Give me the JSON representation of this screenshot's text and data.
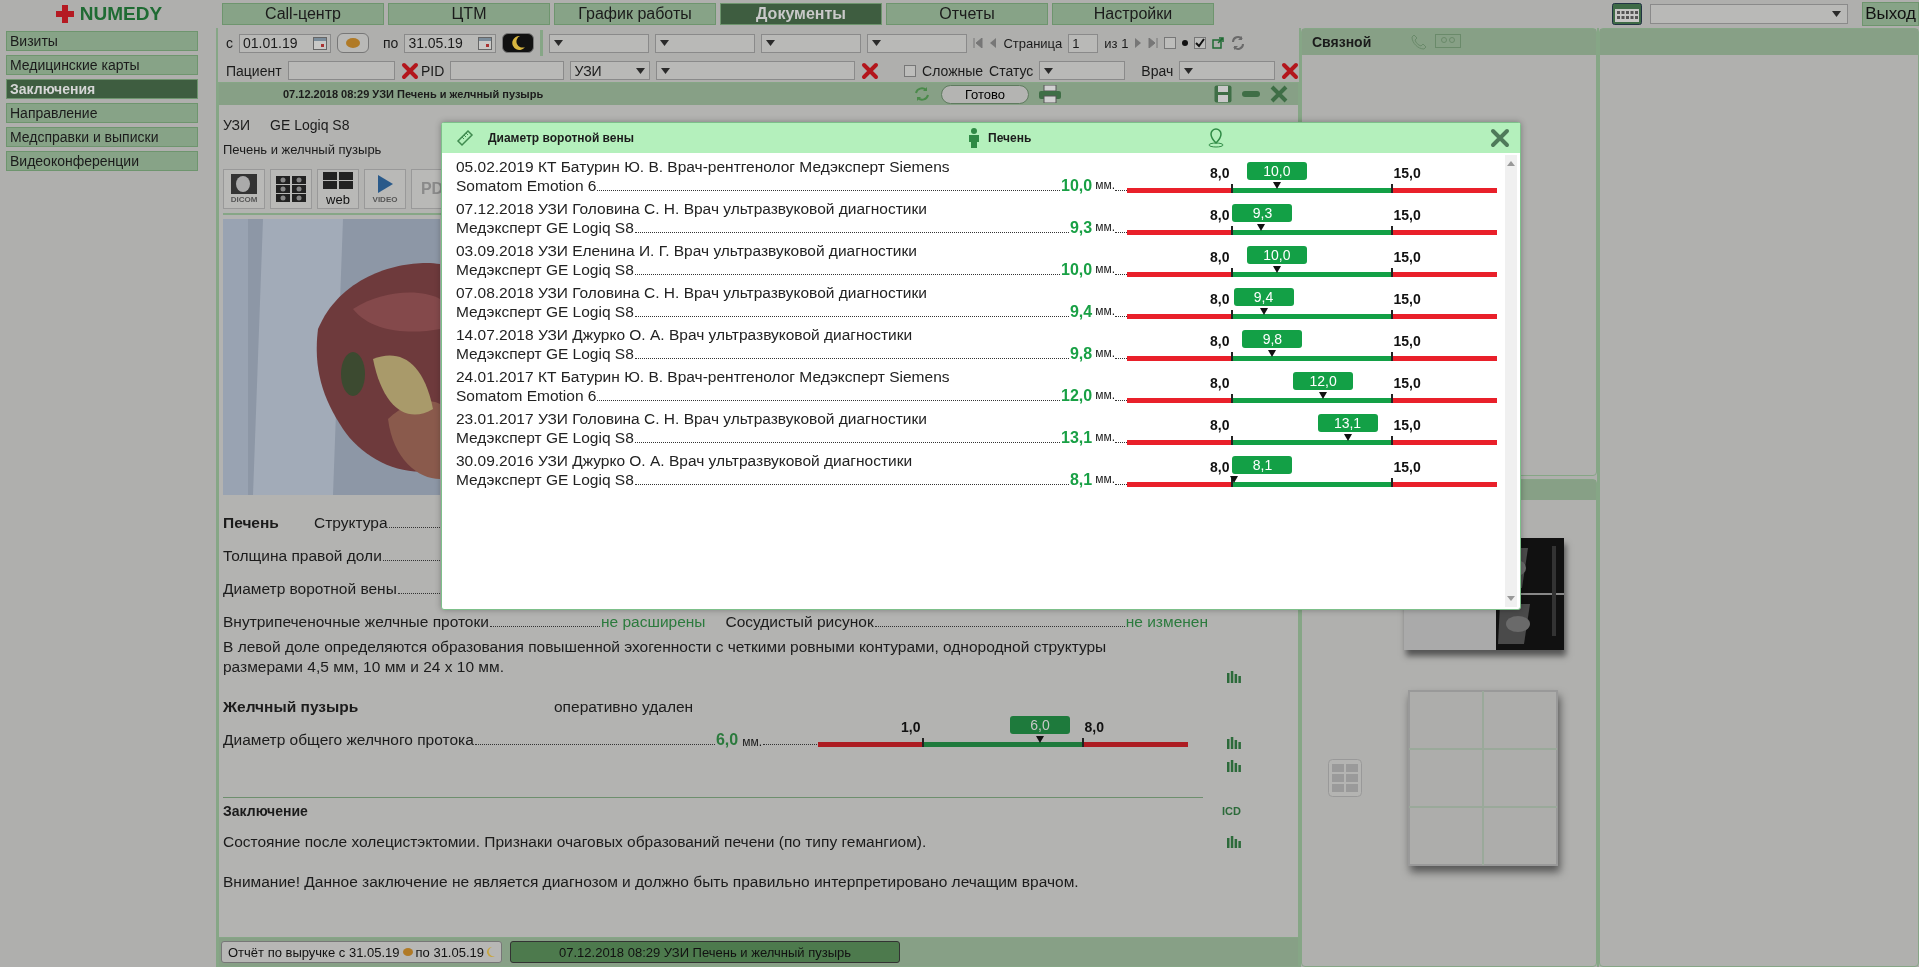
{
  "logo": "NUMEDY",
  "nav_tabs": [
    {
      "label": "Call-центр",
      "selected": false
    },
    {
      "label": "ЦТМ",
      "selected": false
    },
    {
      "label": "График работы",
      "selected": false
    },
    {
      "label": "Документы",
      "selected": true
    },
    {
      "label": "Отчеты",
      "selected": false
    },
    {
      "label": "Настройки",
      "selected": false
    }
  ],
  "exit_button": "Выход",
  "sidebar": {
    "items": [
      {
        "label": "Визиты",
        "selected": false
      },
      {
        "label": "Медицинские карты",
        "selected": false
      },
      {
        "label": "Заключения",
        "selected": true
      },
      {
        "label": "Направление",
        "selected": false
      },
      {
        "label": "Медсправки и выписки",
        "selected": false
      },
      {
        "label": "Видеоконференции",
        "selected": false
      }
    ]
  },
  "filters": {
    "from_label": "с",
    "date_from": "01.01.19",
    "to_label": "по",
    "date_to": "31.05.19",
    "page_label": "Страница",
    "page": "1",
    "page_total": "из 1",
    "show_all": {
      "checked": false
    },
    "show_mine": {
      "checked": true
    },
    "patient_label": "Пациент",
    "pid_label": "PID",
    "modality": "УЗИ",
    "complex": {
      "label": "Сложные",
      "checked": false
    },
    "status_label": "Статус",
    "doctor_label": "Врач"
  },
  "document": {
    "title": "07.12.2018 08:29 УЗИ Печень и желчный пузырь",
    "done_button": "Готово",
    "modality": "УЗИ",
    "device": "GE Logiq S8",
    "study": "Печень и желчный пузырь",
    "media_buttons": [
      {
        "kind": "dicom",
        "label": "DICOM"
      },
      {
        "kind": "images"
      },
      {
        "kind": "web",
        "label": "web"
      },
      {
        "kind": "video",
        "label": "VIDEO"
      },
      {
        "kind": "pdf",
        "label": "PD"
      }
    ],
    "liver": {
      "heading": "Печень",
      "fields": [
        "Структура",
        "Толщина правой доли",
        "Диаметр воротной вены"
      ],
      "pairs": [
        {
          "label": "Внутрипеченочные желчные протоки",
          "value": "не расширены"
        },
        {
          "label": "Сосудистый рисунок",
          "value": "не изменен"
        }
      ],
      "note": "В левой доле определяются образования повышенной эхогенности с четкими ровными контурами, однородной структуры размерами 4,5 мм, 10 мм и 24 х 10 мм."
    },
    "gallbladder": {
      "heading": "Желчный пузырь",
      "status": "оперативно удален",
      "measure": {
        "label": "Диаметр общего желчного протока",
        "value": "6,0",
        "unit": "мм.",
        "min": "1,0",
        "max": "8,0",
        "badge": "6,0",
        "level": 0.6
      }
    },
    "conclusion": {
      "heading": "Заключение",
      "code_label": "ICD",
      "text": "Состояние после холецистэктомии. Признаки очаговых образований печени (по типу гемангиом).",
      "warning": "Внимание! Данное заключение не является диагнозом и должно быть правильно интерпретировано лечащим врачом."
    }
  },
  "contacts_panel": {
    "title": "Связной"
  },
  "bottom_tabs": [
    {
      "label": "Отчёт по выручке с 31.05.19",
      "label_end": "по 31.05.19",
      "selected": false
    },
    {
      "label": "07.12.2018 08:29 УЗИ Печень и желчный пузырь",
      "selected": true
    }
  ],
  "dialog": {
    "title": "Диаметр воротной вены",
    "organ": "Печень",
    "rows": [
      {
        "line1": "05.02.2019 КТ Батурин Ю. В. Врач-рентгенолог Медэксперт Siemens",
        "line2": "Somatom Emotion 6",
        "value": "10,0",
        "unit": "мм.",
        "min": "8,0",
        "max": "15,0",
        "badge": "10,0",
        "level": 0.405
      },
      {
        "line1": "07.12.2018 УЗИ Головина С. Н. Врач ультразвуковой диагностики",
        "line2": "Медэксперт GE Logiq S8",
        "value": "9,3",
        "unit": "мм.",
        "min": "8,0",
        "max": "15,0",
        "badge": "9,3",
        "level": 0.363
      },
      {
        "line1": "03.09.2018 УЗИ Еленина И. Г. Врач ультразвуковой диагностики",
        "line2": "Медэксперт GE Logiq S8",
        "value": "10,0",
        "unit": "мм.",
        "min": "8,0",
        "max": "15,0",
        "badge": "10,0",
        "level": 0.405
      },
      {
        "line1": "07.08.2018 УЗИ Головина С. Н. Врач ультразвуковой диагностики",
        "line2": "Медэксперт GE Logiq S8",
        "value": "9,4",
        "unit": "мм.",
        "min": "8,0",
        "max": "15,0",
        "badge": "9,4",
        "level": 0.369
      },
      {
        "line1": "14.07.2018 УЗИ Джурко О. А. Врач ультразвуковой диагностики",
        "line2": "Медэксперт GE Logiq S8",
        "value": "9,8",
        "unit": "мм.",
        "min": "8,0",
        "max": "15,0",
        "badge": "9,8",
        "level": 0.393
      },
      {
        "line1": "24.01.2017 КТ Батурин Ю. В. Врач-рентгенолог Медэксперт Siemens",
        "line2": "Somatom Emotion 6",
        "value": "12,0",
        "unit": "мм.",
        "min": "8,0",
        "max": "15,0",
        "badge": "12,0",
        "level": 0.53
      },
      {
        "line1": "23.01.2017 УЗИ Головина С. Н. Врач ультразвуковой диагностики",
        "line2": "Медэксперт GE Logiq S8",
        "value": "13,1",
        "unit": "мм.",
        "min": "8,0",
        "max": "15,0",
        "badge": "13,1",
        "level": 0.596
      },
      {
        "line1": "30.09.2016 УЗИ Джурко О. А. Врач ультразвуковой диагностики",
        "line2": "Медэксперт GE Logiq S8",
        "value": "8,1",
        "unit": "мм.",
        "min": "8,0",
        "max": "15,0",
        "badge": "8,1",
        "level": 0.29
      }
    ]
  }
}
